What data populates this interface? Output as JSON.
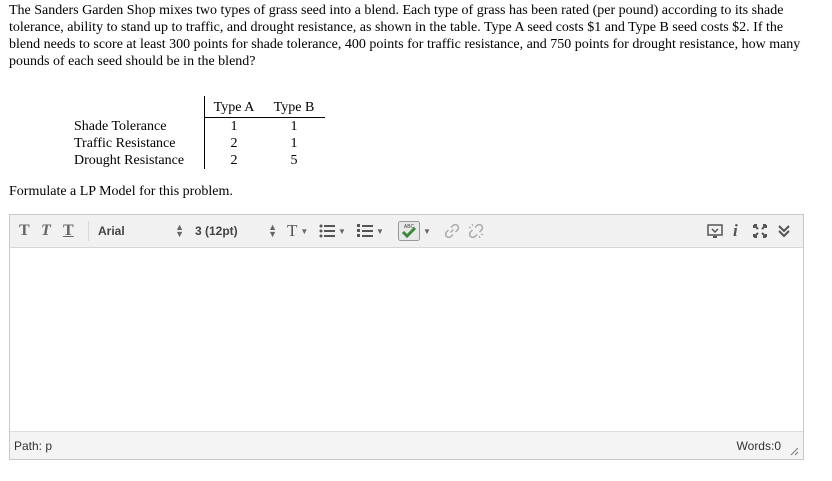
{
  "question": {
    "text": "The Sanders Garden Shop mixes two types of grass seed into a blend. Each type of grass has been rated (per pound) according to its shade tolerance, ability to stand up to traffic, and drought resistance, as shown in the table. Type A seed costs $1 and Type B seed costs $2. If the blend needs to score at least 300 points for shade tolerance, 400 points for traffic resistance, and 750 points for drought resistance, how many pounds of each seed should be in the blend?"
  },
  "table": {
    "headers": [
      "Type A",
      "Type B"
    ],
    "rows": [
      {
        "label": "Shade Tolerance",
        "a": "1",
        "b": "1"
      },
      {
        "label": "Traffic Resistance",
        "a": "2",
        "b": "1"
      },
      {
        "label": "Drought Resistance",
        "a": "2",
        "b": "5"
      }
    ]
  },
  "prompt": "Formulate a LP Model for this problem.",
  "toolbar": {
    "font_family": "Arial",
    "font_size": "3 (12pt)",
    "spellcheck_label": "ABC",
    "icons": [
      "bold-t-icon",
      "italic-t-icon",
      "underline-t-icon",
      "text-color-icon",
      "bullet-list-icon",
      "numbered-list-icon",
      "spellcheck-icon",
      "link-icon",
      "unlink-icon",
      "preview-icon",
      "info-icon",
      "fullscreen-icon",
      "expand-toolbar-icon"
    ]
  },
  "status": {
    "path": "Path: p",
    "words": "Words:0"
  }
}
